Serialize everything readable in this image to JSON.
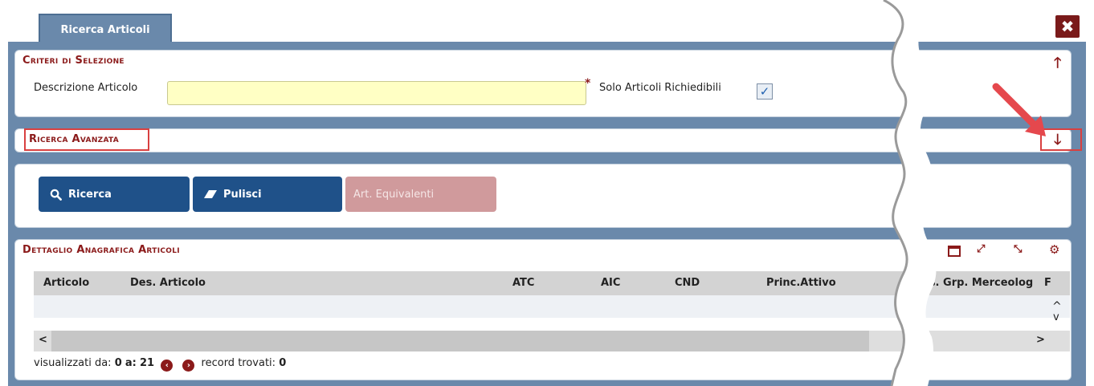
{
  "window": {
    "tab_label": "Ricerca Articoli",
    "close_glyph": "✖"
  },
  "criteri": {
    "title": "Criteri di Selezione",
    "descrizione_label": "Descrizione Articolo",
    "descrizione_value": "",
    "required_mark": "*",
    "solo_label": "Solo Articoli Richiedibili",
    "solo_checked_glyph": "✓",
    "collapse_glyph": "🡑"
  },
  "avanzata": {
    "title": "Ricerca Avanzata",
    "expand_glyph": "🡓"
  },
  "actions": {
    "ricerca_label": "Ricerca",
    "pulisci_label": "Pulisci",
    "equivalenti_label": "Art. Equivalenti"
  },
  "dettaglio": {
    "title": "Dettaglio Anagrafica Articoli",
    "columns": [
      "Articolo",
      "Des. Articolo",
      "ATC",
      "AIC",
      "CND",
      "Princ.Attivo",
      "es. Grp. Merceolog",
      "F"
    ],
    "scroll_left": "<",
    "scroll_right": ">",
    "scroll_up": "^",
    "scroll_down": "v",
    "pager": {
      "prefix": "visualizzati da:",
      "from": "0",
      "to_label": "a:",
      "to": "21",
      "found_label": "record trovati:",
      "found": "0"
    }
  },
  "colors": {
    "frame": "#6a89ab",
    "title_red": "#8b1a1a",
    "button_blue": "#1f5189",
    "button_disabled": "#d09a9c",
    "input_yellow": "#ffffc4",
    "highlight": "#d94040"
  }
}
